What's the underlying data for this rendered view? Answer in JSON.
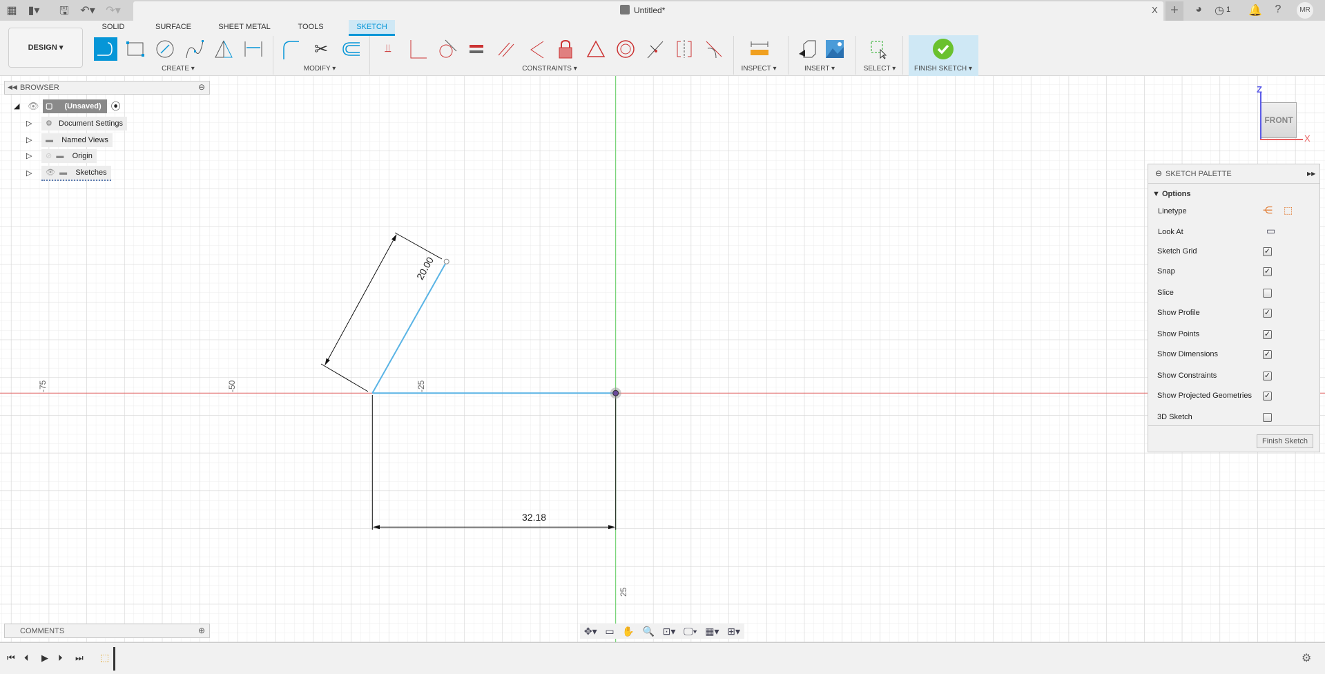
{
  "titlebar": {
    "title": "Untitled*",
    "close": "X",
    "jobs_count": "1",
    "user_initials": "MR",
    "icons": [
      "apps-grid-icon",
      "file-icon",
      "save-icon",
      "undo-icon",
      "redo-icon",
      "new-tab-icon",
      "extensions-icon",
      "job-status-icon",
      "notifications-icon",
      "help-icon"
    ]
  },
  "workspace": {
    "label": "DESIGN"
  },
  "tabs": [
    "SOLID",
    "SURFACE",
    "SHEET METAL",
    "TOOLS",
    "SKETCH"
  ],
  "active_tab": "SKETCH",
  "groups": {
    "create": "CREATE",
    "modify": "MODIFY",
    "constraints": "CONSTRAINTS",
    "inspect": "INSPECT",
    "insert": "INSERT",
    "select": "SELECT",
    "finish": "FINISH SKETCH"
  },
  "browser": {
    "title": "BROWSER",
    "items": [
      {
        "label": "(Unsaved)"
      },
      {
        "label": "Document Settings"
      },
      {
        "label": "Named Views"
      },
      {
        "label": "Origin"
      },
      {
        "label": "Sketches"
      }
    ]
  },
  "comments": {
    "title": "COMMENTS"
  },
  "viewcube": {
    "face": "FRONT",
    "z": "Z",
    "x": "X"
  },
  "sketch": {
    "dim_angled": "20.00",
    "dim_horizontal": "32.18",
    "axis_labels": [
      "-75",
      "-50",
      "-25",
      "25"
    ],
    "line_color": "#5ab4e5",
    "x_axis_color": "#e06060",
    "y_axis_color": "#60d060"
  },
  "palette": {
    "title": "SKETCH PALETTE",
    "section": "Options",
    "rows": [
      {
        "label": "Linetype",
        "type": "icons"
      },
      {
        "label": "Look At",
        "type": "icon"
      },
      {
        "label": "Sketch Grid",
        "checked": true
      },
      {
        "label": "Snap",
        "checked": true
      },
      {
        "label": "Slice",
        "checked": false
      },
      {
        "label": "Show Profile",
        "checked": true
      },
      {
        "label": "Show Points",
        "checked": true
      },
      {
        "label": "Show Dimensions",
        "checked": true
      },
      {
        "label": "Show Constraints",
        "checked": true
      },
      {
        "label": "Show Projected Geometries",
        "checked": true
      },
      {
        "label": "3D Sketch",
        "checked": false
      }
    ],
    "finish_button": "Finish Sketch"
  },
  "accent": "#0696d7"
}
